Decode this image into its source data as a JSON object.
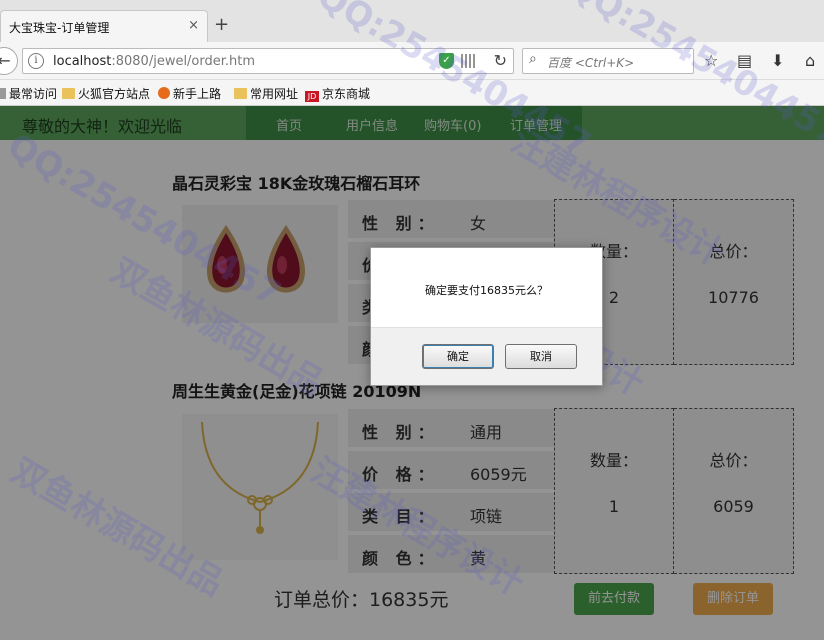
{
  "browser": {
    "tab_title": "大宝珠宝-订单管理",
    "tab_close": "×",
    "new_tab": "+",
    "url_host": "localhost",
    "url_rest": ":8080/jewel/order.htm",
    "search_placeholder": "百度 <Ctrl+K>",
    "bookmarks": [
      "最常访问",
      "火狐官方站点",
      "新手上路",
      "常用网址",
      "京东商城"
    ],
    "jd_logo": "JD"
  },
  "header": {
    "welcome": "尊敬的大神！欢迎光临",
    "menu": [
      "首页",
      "用户信息",
      "购物车(0)",
      "订单管理"
    ]
  },
  "labels": {
    "gender": "性 别：",
    "price": "价 格：",
    "category": "类 目：",
    "color": "颜 色：",
    "quantity": "数量：",
    "total": "总价："
  },
  "products": [
    {
      "name": "晶石灵彩宝 18K金玫瑰石榴石耳环",
      "gender": "女",
      "quantity": "2",
      "total": "10776"
    },
    {
      "name": "周生生黄金(足金)花项链 20109N",
      "gender": "通用",
      "price": "6059元",
      "category": "项链",
      "color": "黄",
      "quantity": "1",
      "total": "6059"
    }
  ],
  "order": {
    "total_text": "订单总价：16835元",
    "pay_button": "前去付款",
    "delete_button": "删除订单"
  },
  "dialog": {
    "message": "确定要支付16835元么？",
    "ok": "确定",
    "cancel": "取消"
  },
  "watermarks": [
    "QQ:2545404457",
    "汪建林程序设计",
    "双鱼林源码出品"
  ],
  "colors": {
    "header_green": "#5da55e",
    "menu_green": "#3f8f47",
    "pay_green": "#4aa54e",
    "delete_orange": "#f0ad4e"
  }
}
